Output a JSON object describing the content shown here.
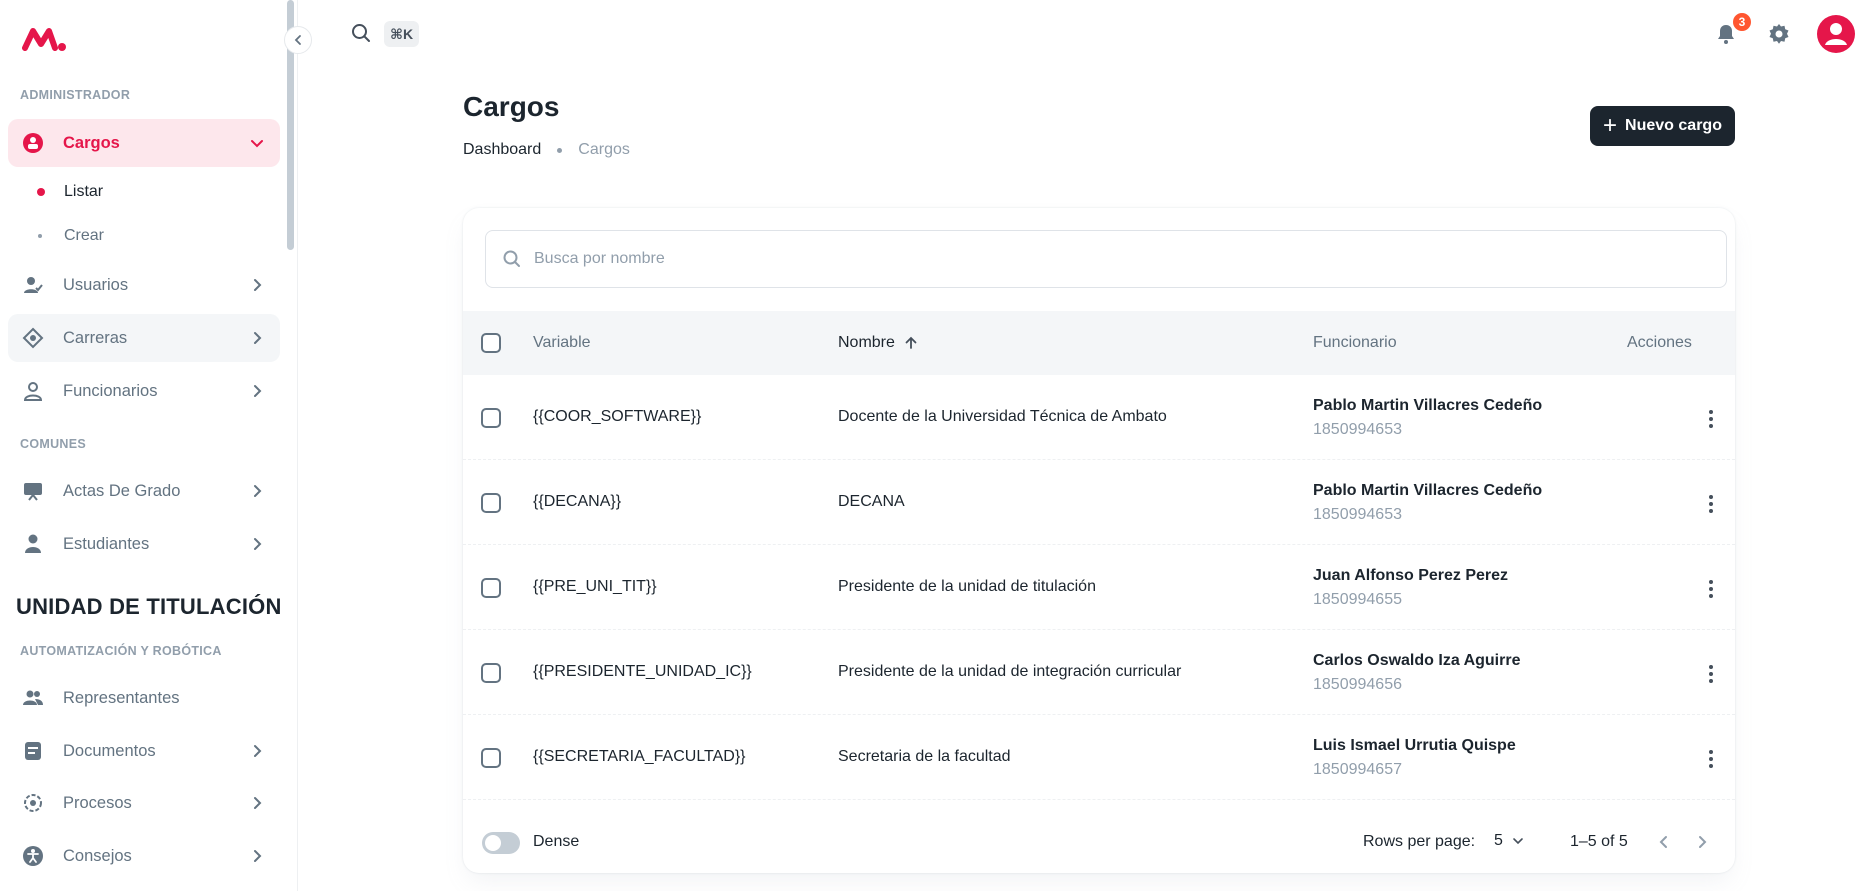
{
  "sidebar": {
    "sections": [
      {
        "label": "ADMINISTRADOR"
      },
      {
        "label": "COMUNES"
      },
      {
        "label": "AUTOMATIZACIÓN Y ROBÓTICA"
      }
    ],
    "group_title": "UNIDAD DE TITULACIÓN",
    "items": {
      "cargos": "Cargos",
      "listar": "Listar",
      "crear": "Crear",
      "usuarios": "Usuarios",
      "carreras": "Carreras",
      "funcionarios": "Funcionarios",
      "actas": "Actas De Grado",
      "estudiantes": "Estudiantes",
      "representantes": "Representantes",
      "documentos": "Documentos",
      "procesos": "Procesos",
      "consejos": "Consejos"
    }
  },
  "header": {
    "search_shortcut": "⌘K",
    "notification_count": "3"
  },
  "page": {
    "title": "Cargos",
    "breadcrumb": [
      "Dashboard",
      "Cargos"
    ],
    "new_button": "Nuevo cargo"
  },
  "table": {
    "search_placeholder": "Busca por nombre",
    "columns": {
      "variable": "Variable",
      "nombre": "Nombre",
      "funcionario": "Funcionario",
      "acciones": "Acciones"
    },
    "rows": [
      {
        "variable": "{{COOR_SOFTWARE}}",
        "nombre": "Docente de la Universidad Técnica de Ambato",
        "funcionario": "Pablo Martin Villacres Cedeño",
        "id": "1850994653"
      },
      {
        "variable": "{{DECANA}}",
        "nombre": "DECANA",
        "funcionario": "Pablo Martin Villacres Cedeño",
        "id": "1850994653"
      },
      {
        "variable": "{{PRE_UNI_TIT}}",
        "nombre": "Presidente de la unidad de titulación",
        "funcionario": "Juan Alfonso Perez Perez",
        "id": "1850994655"
      },
      {
        "variable": "{{PRESIDENTE_UNIDAD_IC}}",
        "nombre": "Presidente de la unidad de integración curricular",
        "funcionario": "Carlos Oswaldo Iza Aguirre",
        "id": "1850994656"
      },
      {
        "variable": "{{SECRETARIA_FACULTAD}}",
        "nombre": "Secretaria de la facultad",
        "funcionario": "Luis Ismael Urrutia Quispe",
        "id": "1850994657"
      }
    ],
    "footer": {
      "dense_label": "Dense",
      "rows_per_page_label": "Rows per page:",
      "rows_per_page": "5",
      "range": "1–5 of 5"
    }
  },
  "colors": {
    "accent": "#e5164a",
    "primary_button": "#1c252e",
    "badge": "#ff5630"
  }
}
